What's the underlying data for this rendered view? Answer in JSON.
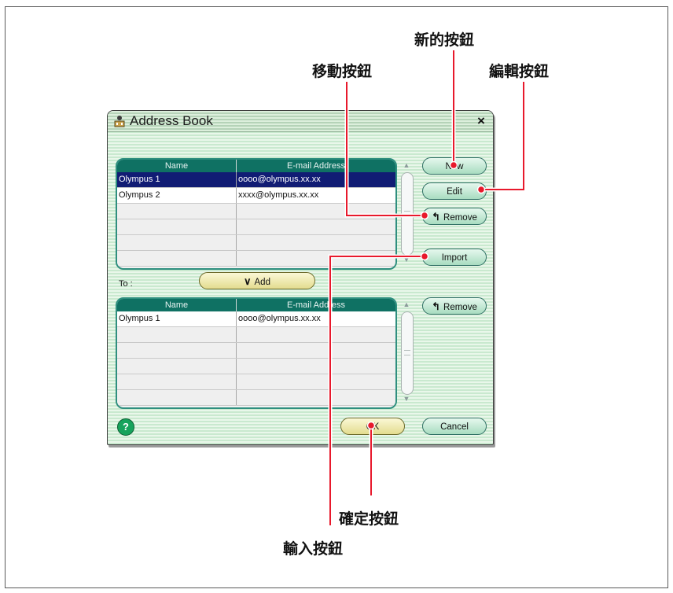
{
  "callouts": {
    "new_button": "新的按鈕",
    "move_button": "移動按鈕",
    "edit_button": "編輯按鈕",
    "ok_button": "確定按鈕",
    "import_button": "輸入按鈕"
  },
  "dialog": {
    "title": "Address Book",
    "close_label": "×",
    "address_table": {
      "headers": [
        "Name",
        "E-mail Address"
      ],
      "rows": [
        {
          "name": "Olympus 1",
          "email": "oooo@olympus.xx.xx"
        },
        {
          "name": "Olympus 2",
          "email": "xxxx@olympus.xx.xx"
        }
      ]
    },
    "buttons": {
      "new": "New",
      "edit": "Edit",
      "remove": "Remove",
      "import": "Import",
      "add": "Add",
      "remove_to": "Remove",
      "ok": "OK",
      "cancel": "Cancel",
      "help": "?"
    },
    "to_label": "To :",
    "to_table": {
      "headers": [
        "Name",
        "E-mail Address"
      ],
      "rows": [
        {
          "name": "Olympus 1",
          "email": "oooo@olympus.xx.xx"
        }
      ]
    }
  },
  "colors": {
    "leader_line": "#e8192c",
    "table_header": "#0f7163",
    "selected_row": "#111c74"
  }
}
